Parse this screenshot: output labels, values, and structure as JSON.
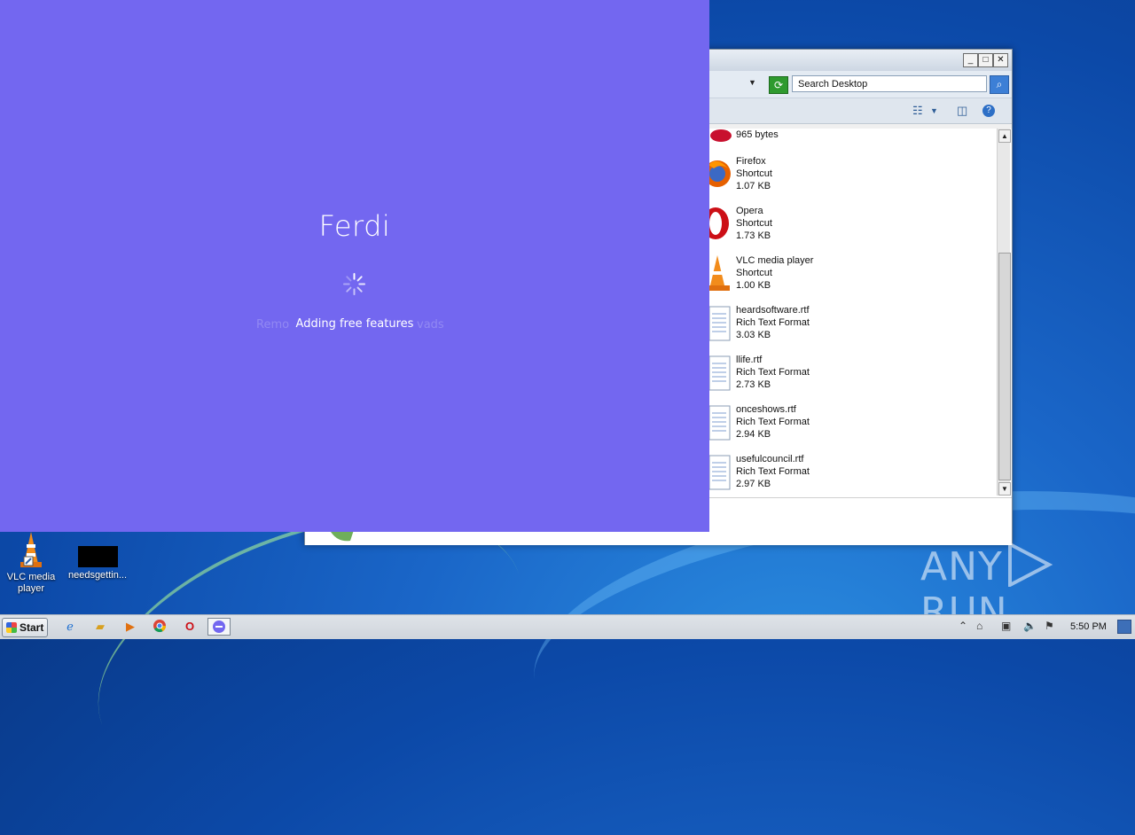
{
  "ferdi": {
    "title": "Ferdi",
    "status": "Adding free features",
    "ghost_left": "Remo",
    "ghost_right": "vads"
  },
  "explorer": {
    "minimize": "_",
    "maximize": "□",
    "close": "✕",
    "search_value": "Search Desktop",
    "files": [
      {
        "name": "965 bytes",
        "kind": "",
        "size": "",
        "icon": "lips-icon"
      },
      {
        "name": "Firefox",
        "kind": "Shortcut",
        "size": "1.07 KB",
        "icon": "firefox-icon"
      },
      {
        "name": "Opera",
        "kind": "Shortcut",
        "size": "1.73 KB",
        "icon": "opera-icon"
      },
      {
        "name": "VLC media player",
        "kind": "Shortcut",
        "size": "1.00 KB",
        "icon": "vlc-icon"
      },
      {
        "name": "heardsoftware.rtf",
        "kind": "Rich Text Format",
        "size": "3.03 KB",
        "icon": "document-icon"
      },
      {
        "name": "llife.rtf",
        "kind": "Rich Text Format",
        "size": "2.73 KB",
        "icon": "document-icon"
      },
      {
        "name": "onceshows.rtf",
        "kind": "Rich Text Format",
        "size": "2.94 KB",
        "icon": "document-icon"
      },
      {
        "name": "usefulcouncil.rtf",
        "kind": "Rich Text Format",
        "size": "2.97 KB",
        "icon": "document-icon"
      }
    ]
  },
  "desktop": {
    "icons": [
      {
        "label": "VLC media player"
      },
      {
        "label": "needsgettin..."
      }
    ]
  },
  "watermark": {
    "left": "ANY",
    "right": "RUN"
  },
  "taskbar": {
    "start_label": "Start",
    "clock": "5:50 PM"
  }
}
